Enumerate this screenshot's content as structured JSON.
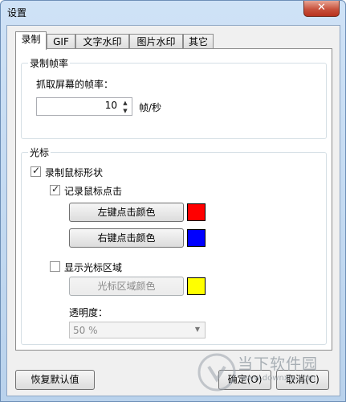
{
  "window": {
    "title": "设置",
    "close_label": "✕"
  },
  "tabs": [
    {
      "label": "录制",
      "active": true
    },
    {
      "label": "GIF",
      "active": false
    },
    {
      "label": "文字水印",
      "active": false
    },
    {
      "label": "图片水印",
      "active": false
    },
    {
      "label": "其它",
      "active": false
    }
  ],
  "framerate_group": {
    "title": "录制帧率",
    "capture_label": "抓取屏幕的帧率：",
    "fps_value": "10",
    "unit_label": "帧/秒"
  },
  "cursor_group": {
    "title": "光标",
    "record_cursor_label": "录制鼠标形状",
    "record_cursor_checked": true,
    "record_clicks_label": "记录鼠标点击",
    "record_clicks_checked": true,
    "left_click_button": "左键点击颜色",
    "left_click_color": "#ff0000",
    "right_click_button": "右键点击颜色",
    "right_click_color": "#0000ff",
    "show_area_label": "显示光标区域",
    "show_area_checked": false,
    "area_color_button": "光标区域颜色",
    "area_color": "#ffff00",
    "opacity_label": "透明度：",
    "opacity_value": "50 %"
  },
  "footer": {
    "reset_button": "恢复默认值",
    "ok_button": "确定(O)",
    "cancel_button": "取消(C)"
  },
  "watermark": {
    "name": "当下软件园",
    "url": "www.downxia.com"
  }
}
